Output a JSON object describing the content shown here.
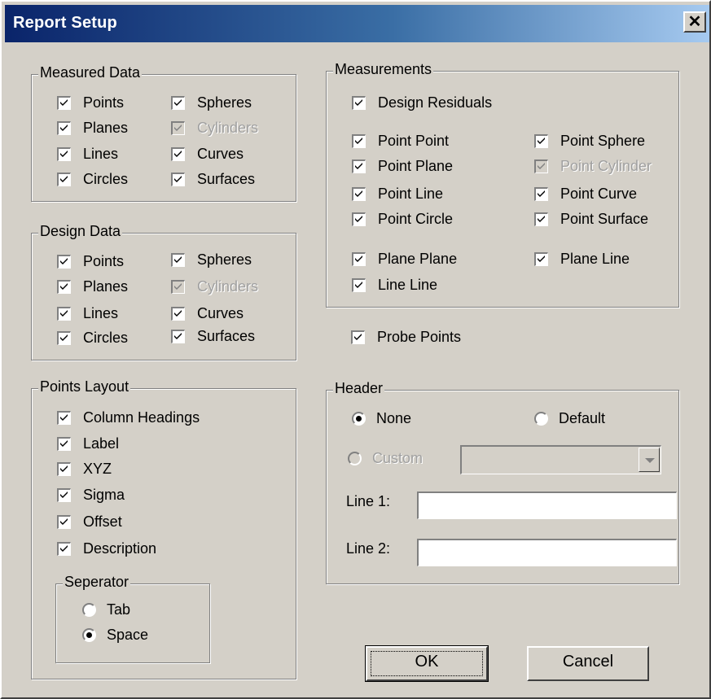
{
  "window": {
    "title": "Report Setup",
    "close_glyph": "✕"
  },
  "measured_data": {
    "title": "Measured Data",
    "items": [
      {
        "label": "Points",
        "checked": true,
        "enabled": true
      },
      {
        "label": "Spheres",
        "checked": true,
        "enabled": true
      },
      {
        "label": "Planes",
        "checked": true,
        "enabled": true
      },
      {
        "label": "Cylinders",
        "checked": true,
        "enabled": false
      },
      {
        "label": "Lines",
        "checked": true,
        "enabled": true
      },
      {
        "label": "Curves",
        "checked": true,
        "enabled": true
      },
      {
        "label": "Circles",
        "checked": true,
        "enabled": true
      },
      {
        "label": "Surfaces",
        "checked": true,
        "enabled": true
      }
    ]
  },
  "design_data": {
    "title": "Design Data",
    "items": [
      {
        "label": "Points",
        "checked": true,
        "enabled": true
      },
      {
        "label": "Spheres",
        "checked": true,
        "enabled": true
      },
      {
        "label": "Planes",
        "checked": true,
        "enabled": true
      },
      {
        "label": "Cylinders",
        "checked": true,
        "enabled": false
      },
      {
        "label": "Lines",
        "checked": true,
        "enabled": true
      },
      {
        "label": "Curves",
        "checked": true,
        "enabled": true
      },
      {
        "label": "Circles",
        "checked": true,
        "enabled": true
      },
      {
        "label": "Surfaces",
        "checked": true,
        "enabled": true
      }
    ]
  },
  "points_layout": {
    "title": "Points Layout",
    "items": [
      {
        "label": "Column Headings",
        "checked": true
      },
      {
        "label": "Label",
        "checked": true
      },
      {
        "label": "XYZ",
        "checked": true
      },
      {
        "label": "Sigma",
        "checked": true
      },
      {
        "label": "Offset",
        "checked": true
      },
      {
        "label": "Description",
        "checked": true
      }
    ],
    "separator": {
      "title": "Seperator",
      "options": [
        {
          "label": "Tab",
          "selected": false
        },
        {
          "label": "Space",
          "selected": true
        }
      ]
    }
  },
  "measurements": {
    "title": "Measurements",
    "items": [
      {
        "label": "Design Residuals",
        "checked": true,
        "enabled": true
      },
      {
        "label": "Point Point",
        "checked": true,
        "enabled": true
      },
      {
        "label": "Point Sphere",
        "checked": true,
        "enabled": true
      },
      {
        "label": "Point Plane",
        "checked": true,
        "enabled": true
      },
      {
        "label": "Point Cylinder",
        "checked": true,
        "enabled": false
      },
      {
        "label": "Point Line",
        "checked": true,
        "enabled": true
      },
      {
        "label": "Point Curve",
        "checked": true,
        "enabled": true
      },
      {
        "label": "Point Circle",
        "checked": true,
        "enabled": true
      },
      {
        "label": "Point Surface",
        "checked": true,
        "enabled": true
      },
      {
        "label": "Plane Plane",
        "checked": true,
        "enabled": true
      },
      {
        "label": "Plane Line",
        "checked": true,
        "enabled": true
      },
      {
        "label": "Line Line",
        "checked": true,
        "enabled": true
      }
    ]
  },
  "probe_points": {
    "label": "Probe Points",
    "checked": true
  },
  "header": {
    "title": "Header",
    "options": [
      {
        "label": "None",
        "selected": true,
        "enabled": true
      },
      {
        "label": "Default",
        "selected": false,
        "enabled": true
      },
      {
        "label": "Custom",
        "selected": false,
        "enabled": false
      }
    ],
    "custom_combo_value": "",
    "line1_label": "Line 1:",
    "line1_value": "",
    "line2_label": "Line 2:",
    "line2_value": ""
  },
  "buttons": {
    "ok": "OK",
    "cancel": "Cancel"
  }
}
